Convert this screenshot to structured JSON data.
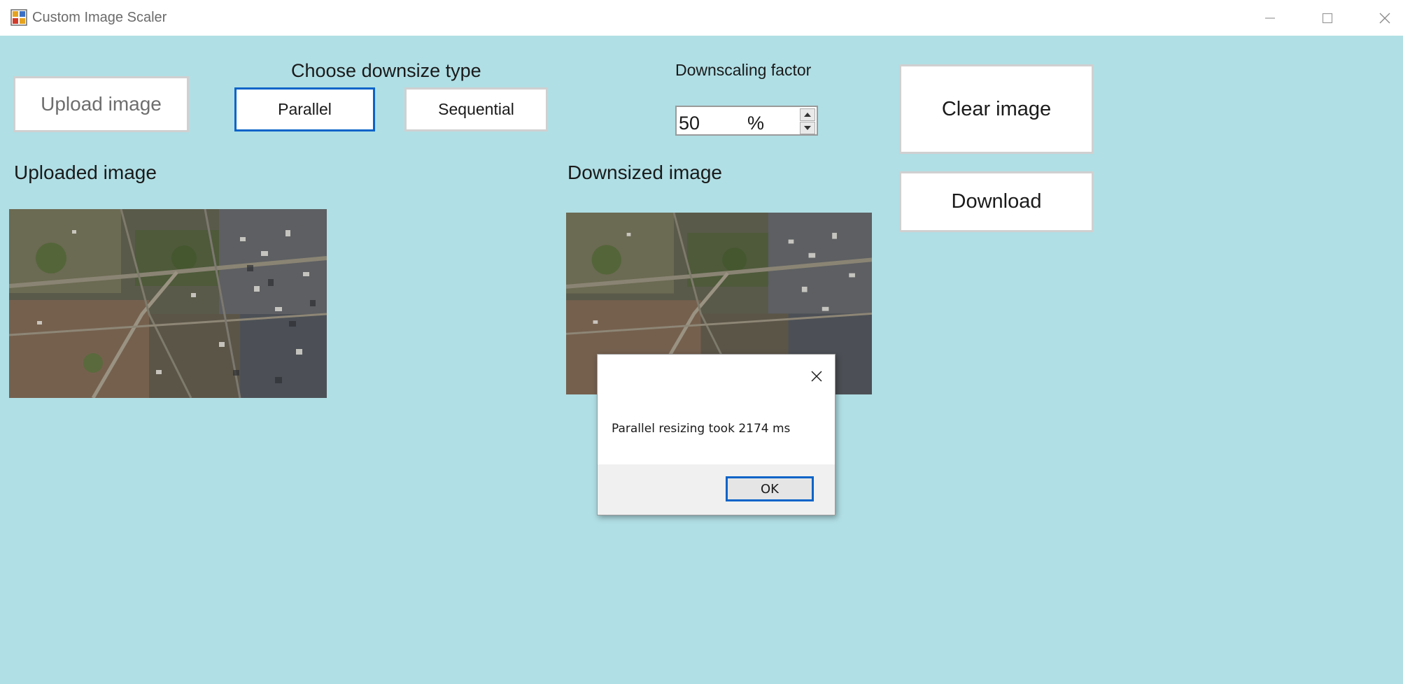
{
  "window": {
    "title": "Custom Image Scaler",
    "icon": "app-icon",
    "controls": [
      "minimize-icon",
      "maximize-icon",
      "close-icon"
    ]
  },
  "toolbar": {
    "upload_label": "Upload image",
    "downsize_type_heading": "Choose downsize type",
    "parallel_label": "Parallel",
    "sequential_label": "Sequential",
    "factor_heading": "Downscaling factor",
    "factor_value": "50",
    "factor_unit": "%",
    "clear_label": "Clear image",
    "download_label": "Download"
  },
  "panels": {
    "uploaded_heading": "Uploaded image",
    "downsized_heading": "Downsized image"
  },
  "dialog": {
    "message": "Parallel resizing took 2174 ms",
    "ok_label": "OK",
    "close_icon": "close-icon"
  },
  "colors": {
    "background": "#b0dfe5",
    "selected_border": "#0a64c8",
    "button_border": "#d0d0d0"
  }
}
